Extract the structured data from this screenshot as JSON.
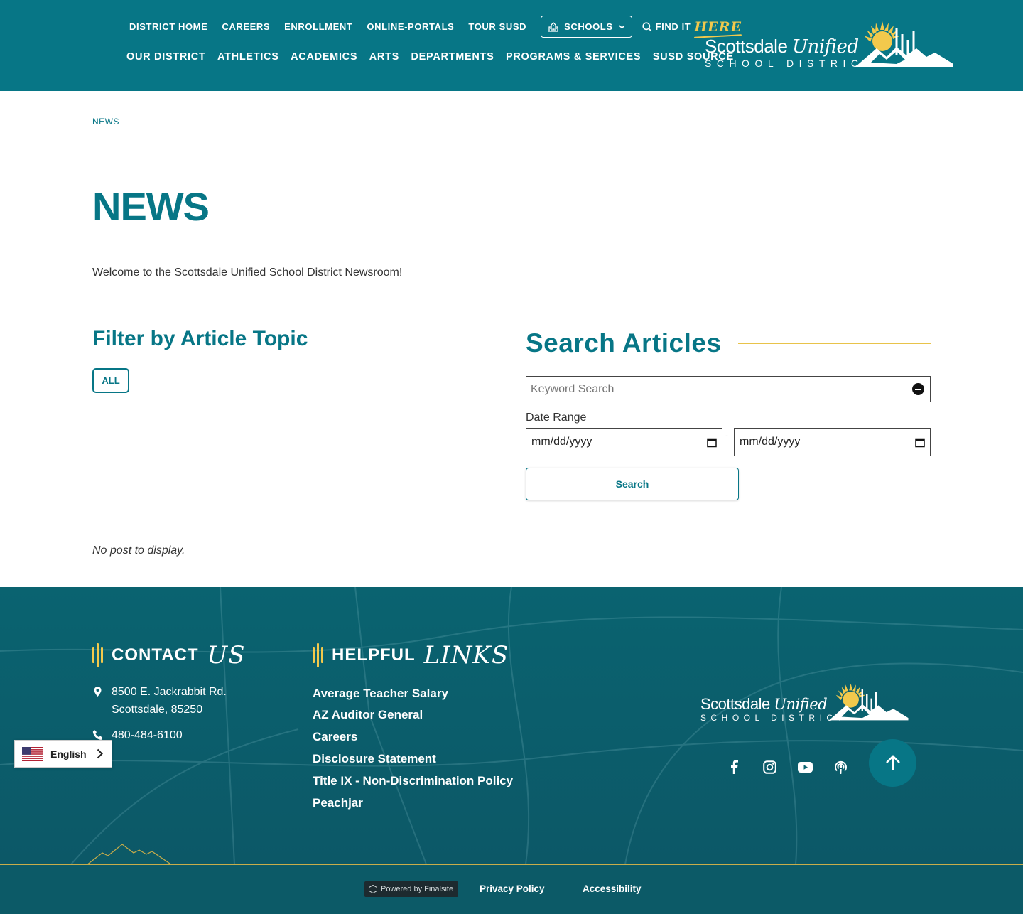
{
  "header": {
    "utility_nav": [
      "DISTRICT HOME",
      "CAREERS",
      "ENROLLMENT",
      "ONLINE-PORTALS",
      "TOUR SUSD"
    ],
    "schools_label": "SCHOOLS",
    "find_it_label": "FIND IT",
    "find_it_script": "HERE",
    "main_nav": [
      "OUR DISTRICT",
      "ATHLETICS",
      "ACADEMICS",
      "ARTS",
      "DEPARTMENTS",
      "PROGRAMS & SERVICES",
      "SUSD SOURCE"
    ],
    "logo": {
      "word": "Scottsdale",
      "script": "Unified",
      "sub": "SCHOOL DISTRICT"
    }
  },
  "breadcrumb": "NEWS",
  "page_title": "NEWS",
  "intro": "Welcome to the Scottsdale Unified School District Newsroom!",
  "filter": {
    "title": "Filter by Article Topic",
    "all_label": "ALL"
  },
  "search": {
    "title": "Search Articles",
    "keyword_placeholder": "Keyword Search",
    "date_range_label": "Date Range",
    "date_from": "mm/dd/yyyy",
    "date_to": "mm/dd/yyyy",
    "date_separator": "-",
    "button_label": "Search"
  },
  "no_post": "No post to display.",
  "footer": {
    "contact_heading": "CONTACT",
    "contact_script": "US",
    "address_line1": "8500 E. Jackrabbit Rd.",
    "address_line2": "Scottsdale, 85250",
    "phone": "480-484-6100",
    "links_heading": "HELPFUL",
    "links_script": "LINKS",
    "links": [
      "Average Teacher Salary",
      "AZ Auditor General",
      "Careers",
      "Disclosure Statement",
      "Title IX - Non-Discrimination Policy",
      "Peachjar"
    ],
    "logo": {
      "word": "Scottsdale",
      "script": "Unified",
      "sub": "SCHOOL DISTRICT"
    },
    "social_icons": [
      "facebook-icon",
      "instagram-icon",
      "youtube-icon",
      "podcast-icon"
    ]
  },
  "bottom": {
    "finalsite": "Powered by Finalsite",
    "privacy": "Privacy Policy",
    "accessibility": "Accessibility"
  },
  "language": {
    "label": "English"
  },
  "colors": {
    "primary": "#077686",
    "accent": "#f2c94c",
    "footer": "#0a6370"
  }
}
